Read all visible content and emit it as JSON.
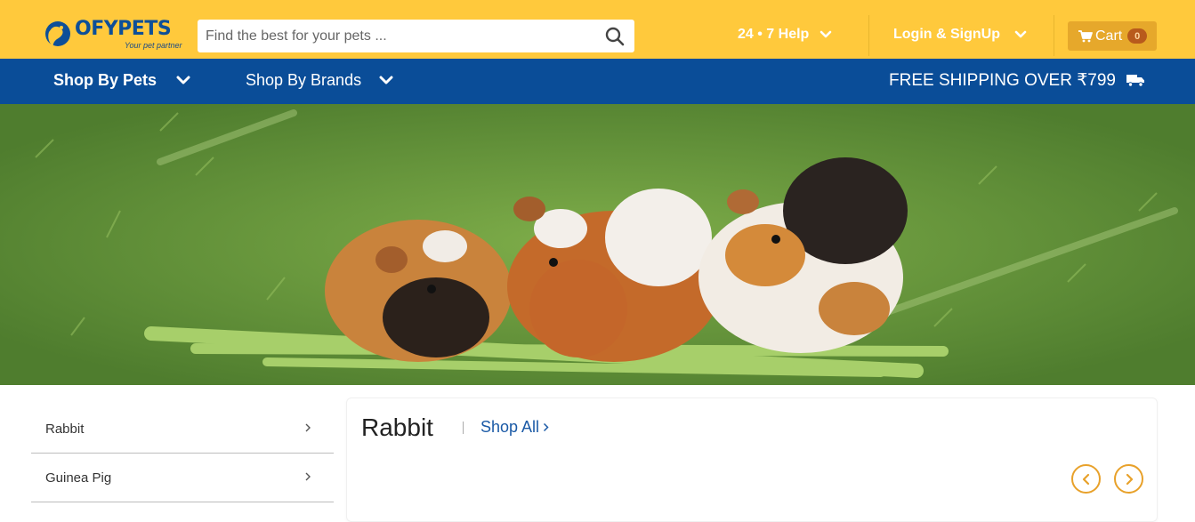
{
  "header": {
    "logo_text": "OFYPETS",
    "logo_tagline": "Your pet partner",
    "search_placeholder": "Find the best for your pets ...",
    "help_label": "24 • 7 Help",
    "login_label": "Login & SignUp",
    "cart_label": "Cart",
    "cart_count": "0"
  },
  "nav": {
    "items": [
      {
        "label": "Shop By Pets"
      },
      {
        "label": "Shop By Brands"
      }
    ],
    "shipping_text": "FREE SHIPPING OVER ₹799"
  },
  "categories": [
    {
      "label": "Rabbit"
    },
    {
      "label": "Guinea Pig"
    }
  ],
  "panel": {
    "title": "Rabbit",
    "shop_all_label": "Shop All"
  },
  "icons": {
    "search": "search-icon",
    "chevron": "chevron-down-icon",
    "cart": "cart-icon",
    "truck": "truck-icon",
    "arrow_right": "chevron-right-icon",
    "arrow_left": "chevron-left-icon"
  },
  "colors": {
    "topbar": "#ffc93c",
    "navbar": "#0a4d98",
    "cart_button": "#e6a82b",
    "accent_orange": "#e8a12a",
    "link_blue": "#1b5aa6"
  }
}
